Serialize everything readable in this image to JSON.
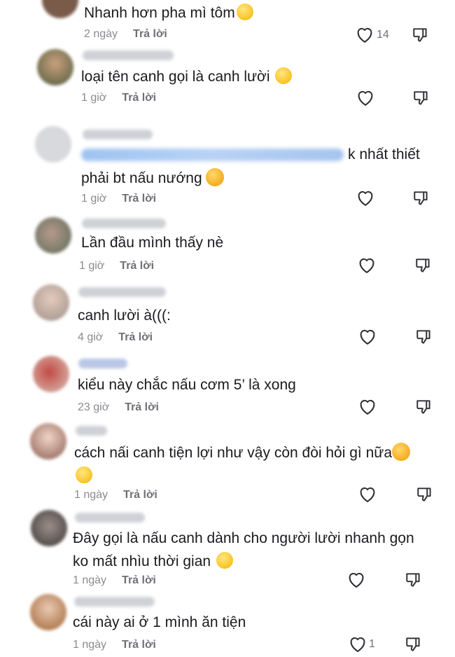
{
  "comments": [
    {
      "text": "Nhanh hơn pha mì tôm",
      "time": "2 ngày",
      "reply": "Trả lời",
      "likes": "14"
    },
    {
      "text": "loại tên canh gọi là canh lười",
      "time": "1 giờ",
      "reply": "Trả lời",
      "likes": ""
    },
    {
      "text_line1_suffix": "k nhất thiết",
      "text_line2": "phải bt nấu nướng",
      "time": "1 giờ",
      "reply": "Trả lời",
      "likes": ""
    },
    {
      "text": "Lần đầu mình thấy nè",
      "time": "1 giờ",
      "reply": "Trả lời",
      "likes": ""
    },
    {
      "text": "canh lười à(((:",
      "time": "4 giờ",
      "reply": "Trả lời",
      "likes": ""
    },
    {
      "text": "kiểu này chắc nấu cơm 5’ là xong",
      "time": "23 giờ",
      "reply": "Trả lời",
      "likes": ""
    },
    {
      "text": "cách nấi canh tiện lợi như vậy còn đòi hỏi gì nữa",
      "time": "1 ngày",
      "reply": "Trả lời",
      "likes": ""
    },
    {
      "text_line1": "Đây gọi là nấu canh dành cho người lười nhanh gọn",
      "text_line2": "ko mất nhìu thời gian",
      "time": "1 ngày",
      "reply": "Trả lời",
      "likes": ""
    },
    {
      "text": "cái này ai ở 1 mình ăn tiện",
      "time": "1 ngày",
      "reply": "Trả lời",
      "likes": "1"
    }
  ],
  "icons": {
    "like": "heart-outline-icon",
    "dislike": "thumbs-down-outline-icon",
    "emoji": "laughing-emoji"
  },
  "colors": {
    "text": "#1b1b1f",
    "meta": "#8a8b91",
    "mention": "#9ec3f0"
  }
}
